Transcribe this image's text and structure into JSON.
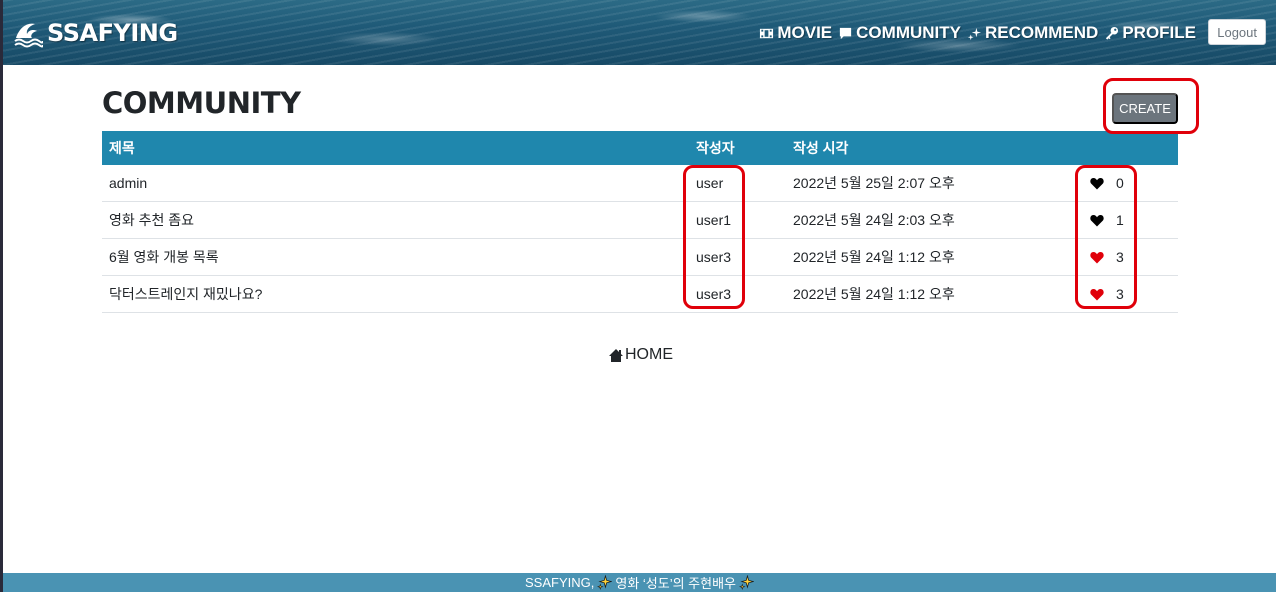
{
  "navbar": {
    "brand": "SSAFYING",
    "links": [
      {
        "label": "MOVIE",
        "icon": "film-icon"
      },
      {
        "label": "COMMUNITY",
        "icon": "chat-icon"
      },
      {
        "label": "RECOMMEND",
        "icon": "sparkles-icon"
      },
      {
        "label": "PROFILE",
        "icon": "key-icon"
      }
    ],
    "logout_label": "Logout"
  },
  "main": {
    "title": "COMMUNITY",
    "create_label": "CREATE",
    "table": {
      "headers": [
        "제목",
        "작성자",
        "작성 시각",
        ""
      ],
      "rows": [
        {
          "title": "admin",
          "author": "user",
          "time": "2022년 5월 25일 2:07 오후",
          "likes": "0",
          "liked": false
        },
        {
          "title": "영화 추천 좀요",
          "author": "user1",
          "time": "2022년 5월 24일 2:03 오후",
          "likes": "1",
          "liked": false
        },
        {
          "title": "6월 영화 개봉 목록",
          "author": "user3",
          "time": "2022년 5월 24일 1:12 오후",
          "likes": "3",
          "liked": true
        },
        {
          "title": "닥터스트레인지 재밌나요?",
          "author": "user3",
          "time": "2022년 5월 24일 1:12 오후",
          "likes": "3",
          "liked": true
        }
      ]
    },
    "home_label": "HOME"
  },
  "footer": {
    "text_before": "SSAFYING,",
    "text_main": "영화 ‘성도’의 주현배우"
  },
  "colors": {
    "table_header": "#1f87ad",
    "heart_liked": "#e0000a",
    "heart_unliked": "#000000",
    "highlight": "#e0000a",
    "footer": "#4a93b3",
    "create_button": "#6c757d"
  }
}
